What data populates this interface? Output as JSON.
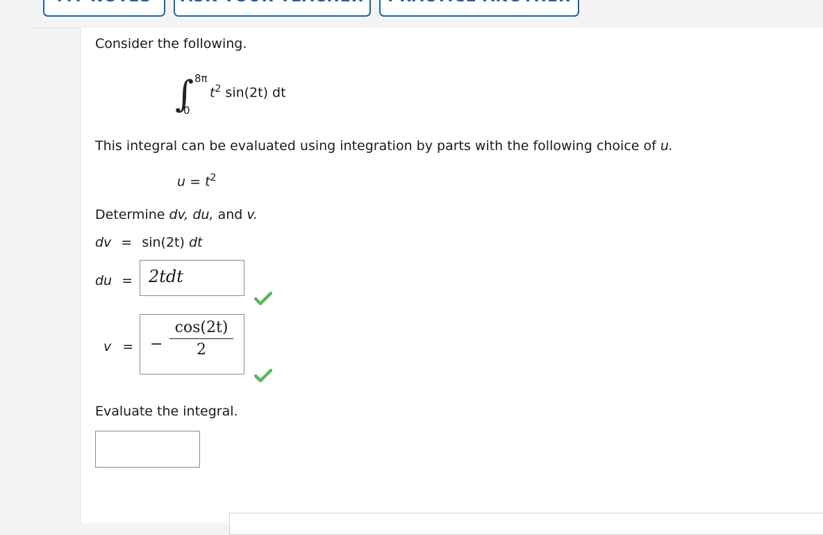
{
  "top_buttons": [
    {
      "label": "MY NOTES"
    },
    {
      "label": "ASK YOUR TEACHER"
    },
    {
      "label": "PRACTICE ANOTHER"
    }
  ],
  "problem": {
    "intro": "Consider the following.",
    "integral": {
      "upper": "8π",
      "lower": "0",
      "integrand_prefix": "t",
      "exponent": "2",
      "integrand_suffix": "sin(2t) dt"
    },
    "parts_text": "This integral can be evaluated using integration by parts with the following choice of",
    "parts_var": "u.",
    "u_choice": {
      "lhs": "u",
      "eq": "=",
      "rhs": "t",
      "exp": "2"
    },
    "determine_text": {
      "prefix": "Determine",
      "dv": "dv,",
      "du": "du,",
      "and": "and",
      "v": "v."
    },
    "dv_line": {
      "lhs": "dv",
      "eq": "=",
      "rhs_fn": "sin(2t)",
      "rhs_d": "dt"
    },
    "du_field": {
      "label": "du",
      "eq": "=",
      "value": "2tdt",
      "status": "correct"
    },
    "v_field": {
      "label": "v",
      "eq": "=",
      "sign": "−",
      "numerator": "cos(2t)",
      "denominator": "2",
      "status": "correct"
    },
    "evaluate_text": "Evaluate the integral.",
    "evaluate_field": {
      "value": ""
    }
  },
  "colors": {
    "accent": "#1d63a8",
    "check": "#5cb85c"
  }
}
